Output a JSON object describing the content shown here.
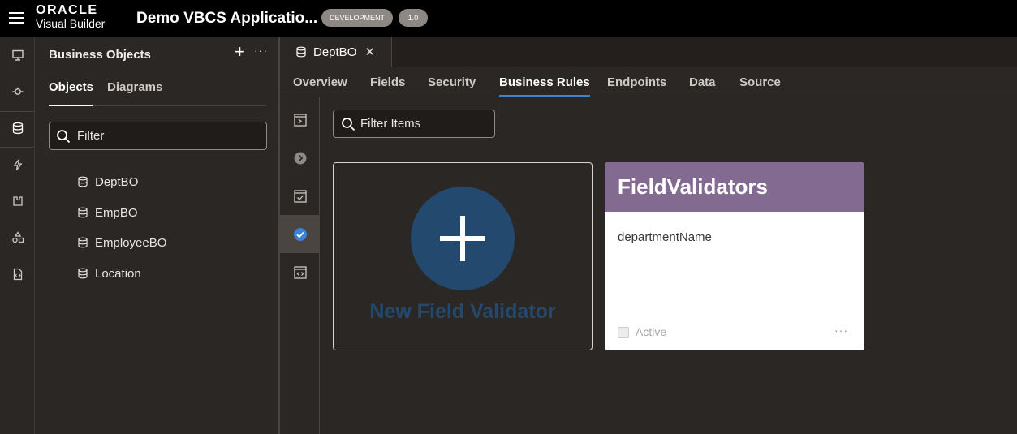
{
  "header": {
    "brand": "ORACLE",
    "product": "Visual Builder",
    "app_title": "Demo VBCS Applicatio...",
    "env_badge": "DEVELOPMENT",
    "version_badge": "1.0"
  },
  "rail": {
    "icons": [
      "monitor-icon",
      "service-connection-icon",
      "database-icon",
      "lightning-icon",
      "component-icon",
      "shapes-icon",
      "source-file-icon"
    ]
  },
  "bo_panel": {
    "title": "Business Objects",
    "add_label": "+",
    "more_label": "···",
    "tabs": [
      "Objects",
      "Diagrams"
    ],
    "filter_placeholder": "Filter",
    "items": [
      "DeptBO",
      "EmpBO",
      "EmployeeBO",
      "Location"
    ]
  },
  "editor": {
    "file_tab": "DeptBO",
    "close_label": "✕",
    "subtabs": [
      "Overview",
      "Fields",
      "Security",
      "Business Rules",
      "Endpoints",
      "Data",
      "Source"
    ],
    "active_subtab": "Business Rules",
    "filter_placeholder": "Filter Items"
  },
  "cards": {
    "new_label": "New Field Validator",
    "validator": {
      "title": "FieldValidators",
      "field": "departmentName",
      "active_label": "Active",
      "more_label": "···"
    }
  },
  "colors": {
    "accent": "#3a83d8",
    "card_header": "#826a91",
    "new_circle": "#234a6e"
  }
}
